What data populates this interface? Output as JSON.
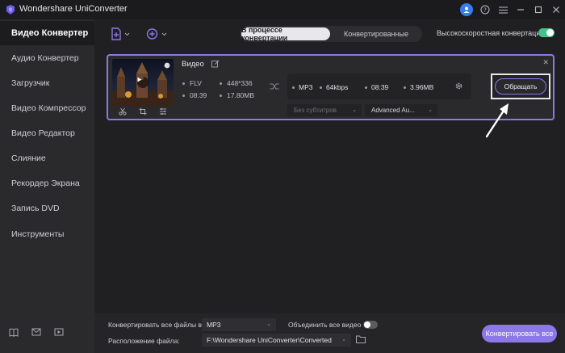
{
  "app": {
    "title": "Wondershare UniConverter"
  },
  "sidebar": {
    "items": [
      {
        "label": "Видео Конвертер",
        "active": true
      },
      {
        "label": "Аудио Конвертер"
      },
      {
        "label": "Загрузчик"
      },
      {
        "label": "Видео Компрессор"
      },
      {
        "label": "Видео Редактор"
      },
      {
        "label": "Слияние"
      },
      {
        "label": "Рекордер Экрана"
      },
      {
        "label": "Запись DVD"
      },
      {
        "label": "Инструменты"
      }
    ]
  },
  "toolbar": {
    "tabs": [
      {
        "label": "В процессе конвертации",
        "active": true
      },
      {
        "label": "Конвертированные"
      }
    ],
    "high_speed_label": "Высокоскоростная конвертация",
    "high_speed_enabled": true
  },
  "file": {
    "name": "Видео",
    "source": {
      "format": "FLV",
      "resolution": "448*336",
      "duration": "08:39",
      "size": "17.80MB"
    },
    "output": {
      "format": "MP3",
      "bitrate": "64kbps",
      "duration": "08:39",
      "size": "3.96MB"
    },
    "subtitle": "Без субтитров",
    "audio": "Advanced Au...",
    "convert_label": "Обращать"
  },
  "bottom": {
    "convert_all_to_label": "Конвертировать все файлы в:",
    "convert_all_to_value": "MP3",
    "merge_label": "Объединить все видео",
    "merge_enabled": false,
    "location_label": "Расположение файла:",
    "location_value": "F:\\Wondershare UniConverter\\Converted",
    "convert_all_button": "Конвертировать все"
  },
  "colors": {
    "accent": "#8c78e8",
    "toggle_on": "#45c28a",
    "user": "#3b7bf0"
  }
}
